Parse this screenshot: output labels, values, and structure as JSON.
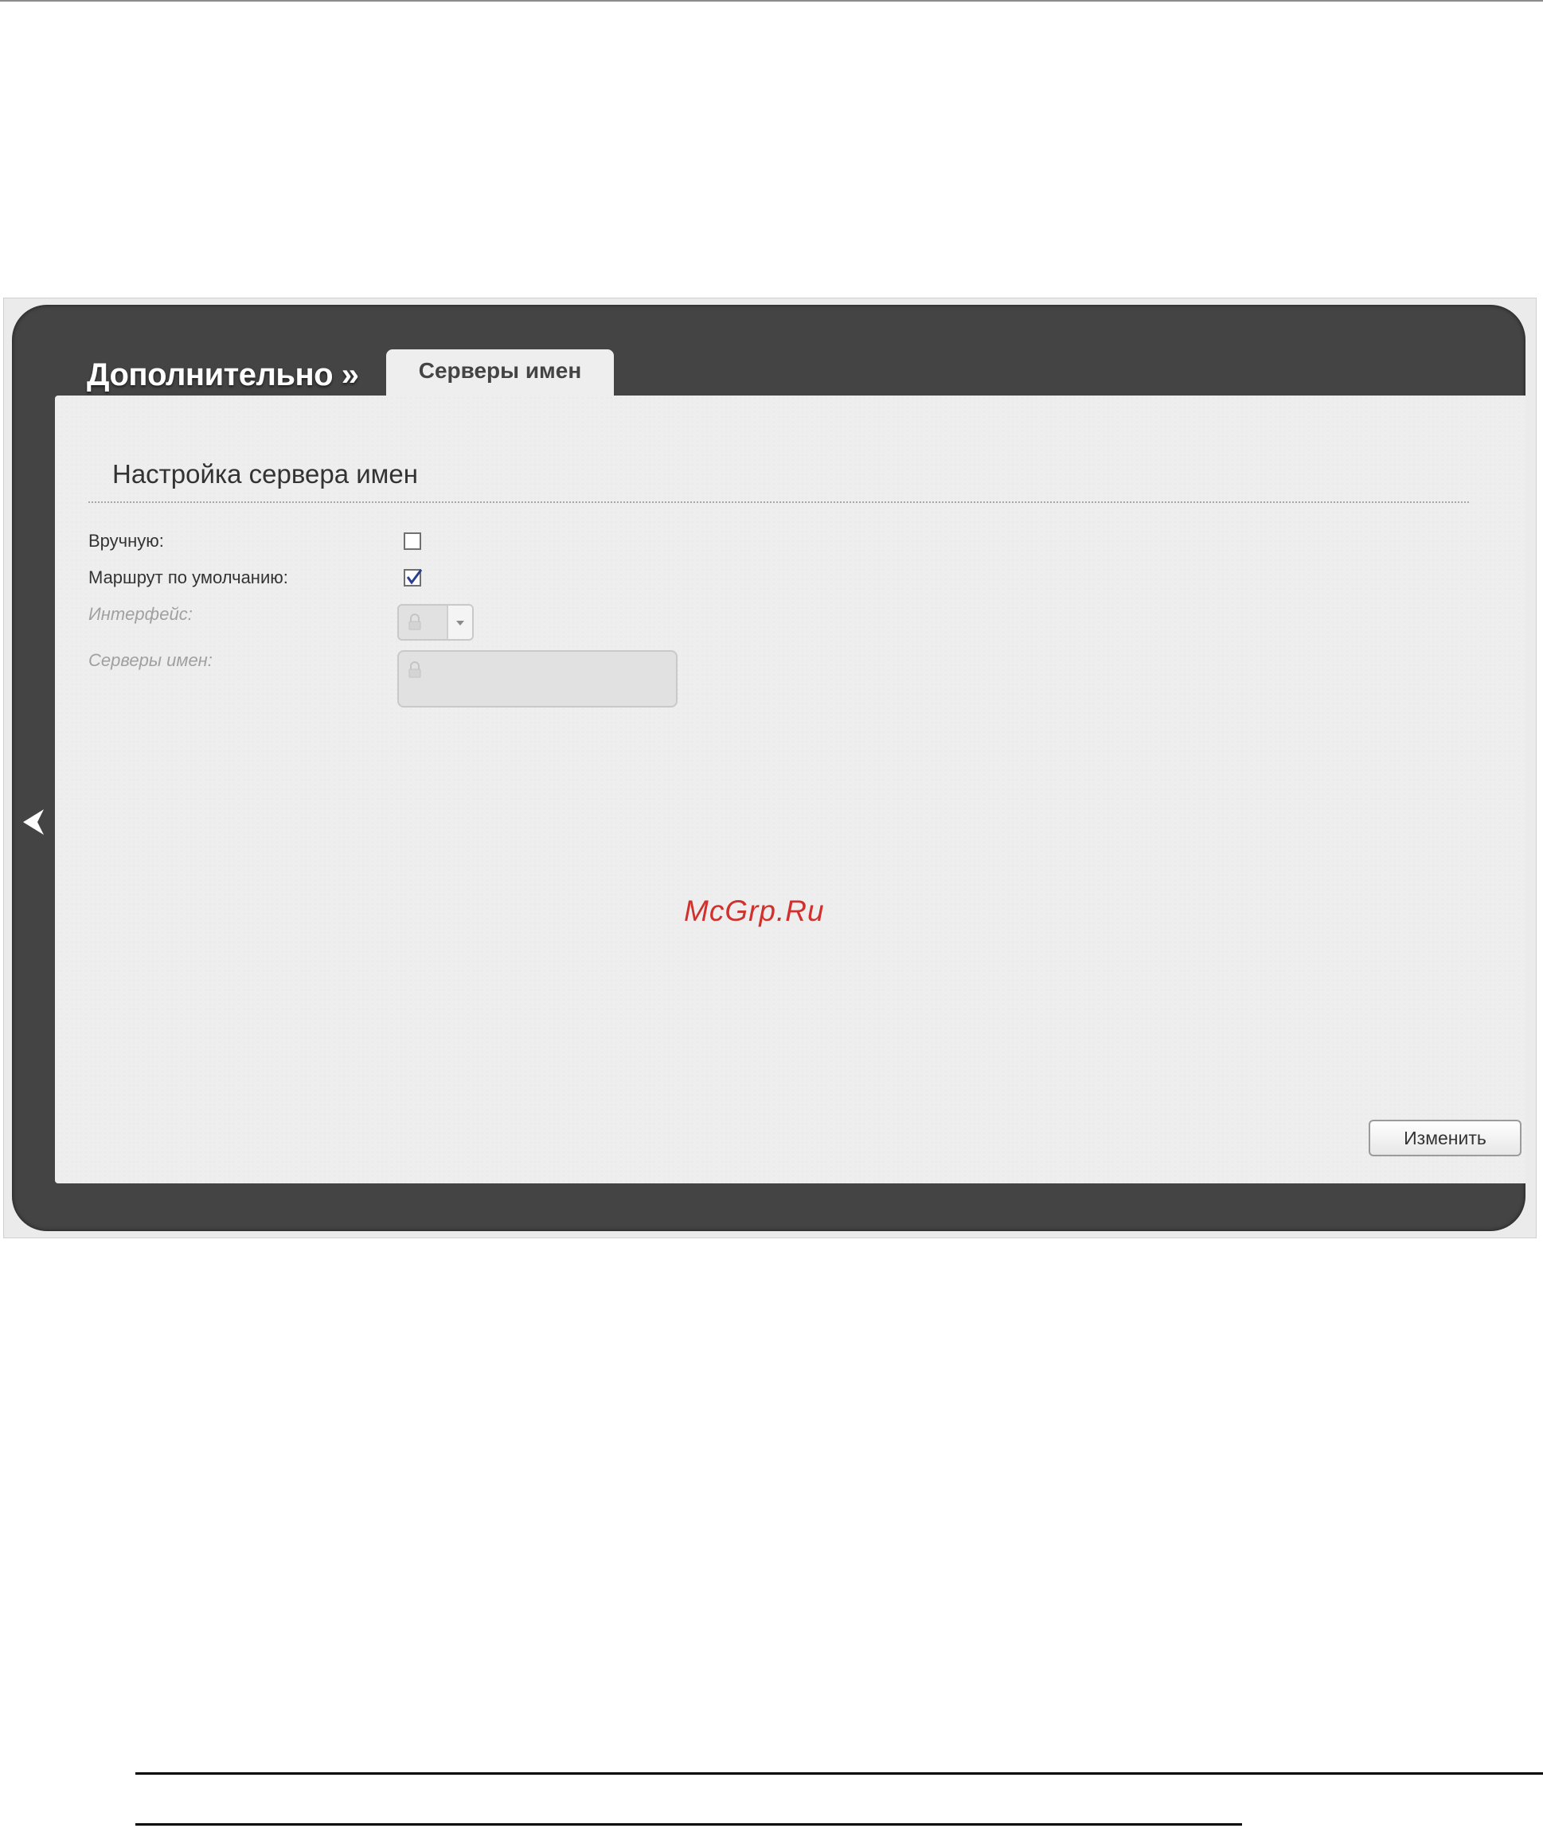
{
  "header": {
    "section_title": "Дополнительно »",
    "active_tab": "Серверы имен"
  },
  "form": {
    "heading": "Настройка сервера имен",
    "manual": {
      "label": "Вручную:",
      "checked": false
    },
    "default_route": {
      "label": "Маршрут по умолчанию:",
      "checked": true
    },
    "interface": {
      "label": "Интерфейс:",
      "value": "",
      "disabled": true
    },
    "name_servers": {
      "label": "Серверы имен:",
      "value": "",
      "disabled": true
    }
  },
  "actions": {
    "apply_label": "Изменить"
  },
  "watermark": "McGrp.Ru",
  "icons": {
    "back": "chevron-left-icon",
    "lock": "lock-icon",
    "dropdown": "chevron-down-icon",
    "check": "checkmark-icon"
  },
  "colors": {
    "panel": "#444444",
    "content": "#eeeeee",
    "watermark": "#d0312d"
  }
}
